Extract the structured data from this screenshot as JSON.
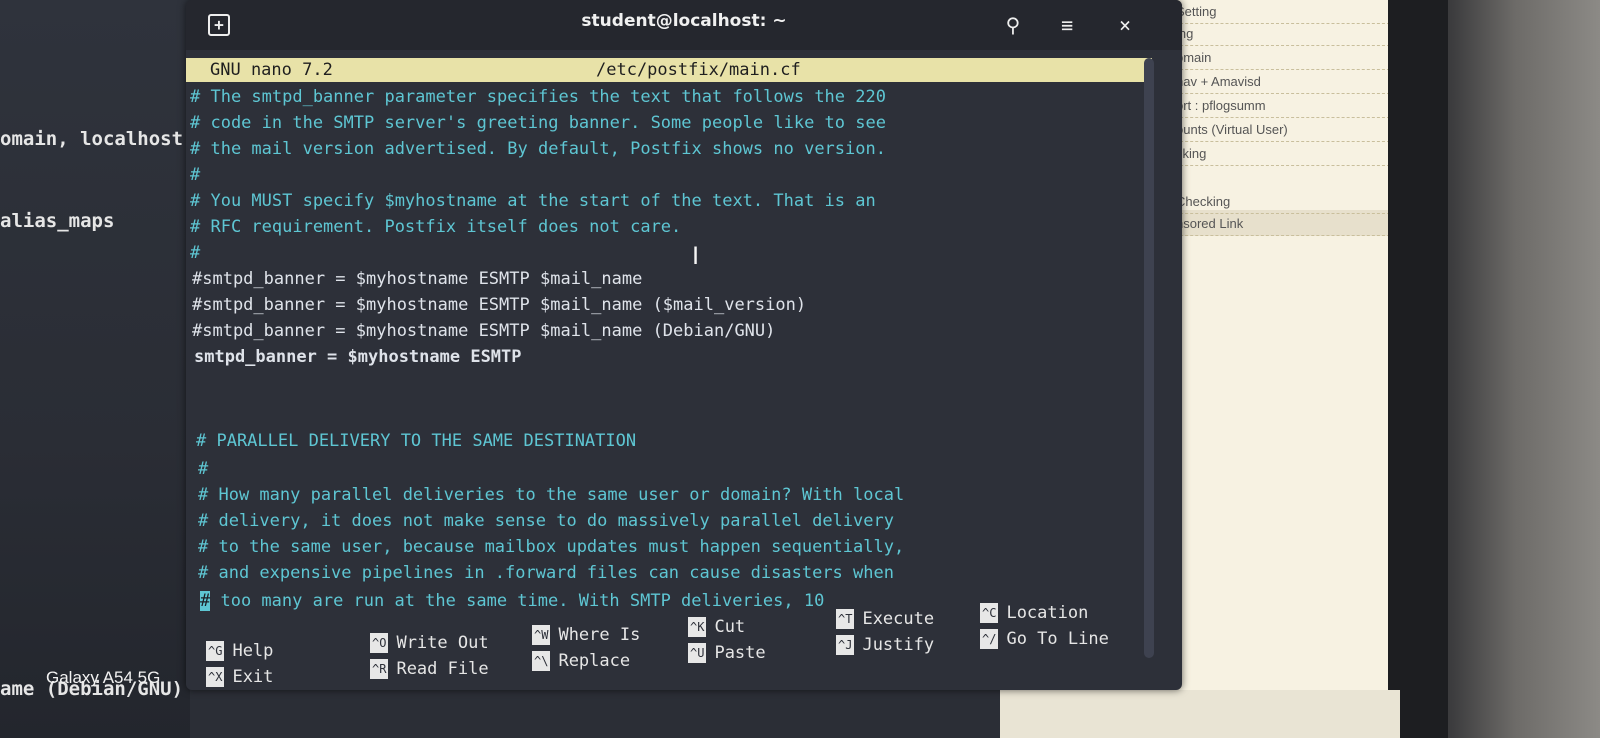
{
  "background": {
    "left_lines": [
      "omain, localhost",
      "alias_maps",
      "ame (Debian/GNU)"
    ],
    "phone_label": "Galaxy A54 5G",
    "right_panel_items": [
      "Setting",
      "ing",
      "omain",
      "nav + Amavisd",
      "ort : pflogsumm",
      "ounts (Virtual User)",
      "cking",
      "Checking",
      "nsored Link"
    ]
  },
  "window": {
    "title": "student@localhost: ~",
    "newtab_glyph": "+",
    "search_glyph": "⚲",
    "menu_glyph": "≡",
    "close_glyph": "×"
  },
  "nano": {
    "version": "GNU nano 7.2",
    "filename": "/etc/postfix/main.cf",
    "lines": [
      "# The smtpd_banner parameter specifies the text that follows the 220",
      "# code in the SMTP server's greeting banner. Some people like to see",
      "# the mail version advertised. By default, Postfix shows no version.",
      "#",
      "# You MUST specify $myhostname at the start of the text. That is an",
      "# RFC requirement. Postfix itself does not care.",
      "#",
      "#smtpd_banner = $myhostname ESMTP $mail_name",
      "#smtpd_banner = $myhostname ESMTP $mail_name ($mail_version)",
      "#smtpd_banner = $myhostname ESMTP $mail_name (Debian/GNU)",
      "smtpd_banner = $myhostname ESMTP",
      "",
      "",
      "# PARALLEL DELIVERY TO THE SAME DESTINATION",
      "#",
      "# How many parallel deliveries to the same user or domain? With local",
      "# delivery, it does not make sense to do massively parallel delivery",
      "# to the same user, because mailbox updates must happen sequentially,",
      "# and expensive pipelines in .forward files can cause disasters when",
      "# too many are run at the same time. With SMTP deliveries, 10"
    ],
    "last_line_cursor": "#",
    "last_line_rest": " too many are run at the same time. With SMTP deliveries, 10",
    "shortcuts": [
      {
        "key": "^G",
        "label": "Help"
      },
      {
        "key": "^X",
        "label": "Exit"
      },
      {
        "key": "^O",
        "label": "Write Out"
      },
      {
        "key": "^R",
        "label": "Read File"
      },
      {
        "key": "^W",
        "label": "Where Is"
      },
      {
        "key": "^\\",
        "label": "Replace"
      },
      {
        "key": "^K",
        "label": "Cut"
      },
      {
        "key": "^U",
        "label": "Paste"
      },
      {
        "key": "^T",
        "label": "Execute"
      },
      {
        "key": "^J",
        "label": "Justify"
      },
      {
        "key": "^C",
        "label": "Location"
      },
      {
        "key": "^/",
        "label": "Go To Line"
      }
    ]
  }
}
